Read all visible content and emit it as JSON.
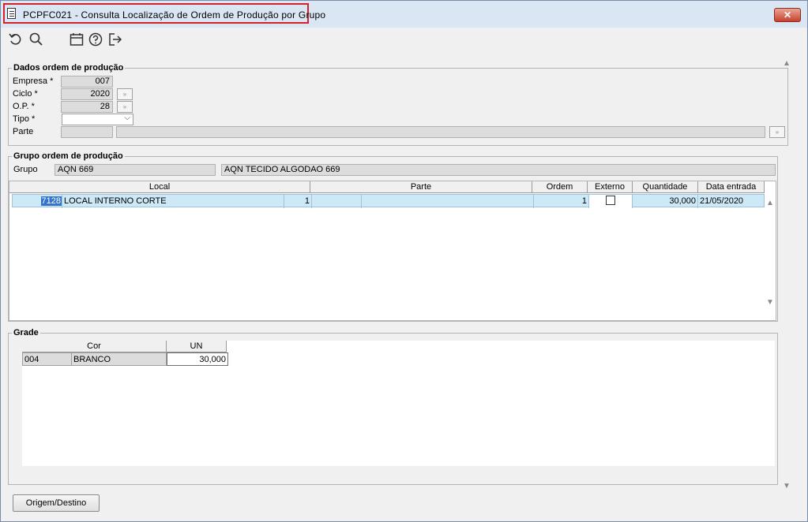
{
  "window": {
    "title": "PCPFC021 - Consulta Localização de Ordem de Produção por Grupo",
    "close_label": "✕"
  },
  "toolbar": {
    "icons": [
      "undo-icon",
      "search-icon",
      "calendar-icon",
      "help-icon",
      "exit-icon"
    ]
  },
  "dados": {
    "legend": "Dados ordem de produção",
    "empresa_label": "Empresa *",
    "empresa_value": "007",
    "ciclo_label": "Ciclo *",
    "ciclo_value": "2020",
    "op_label": "O.P. *",
    "op_value": "28",
    "tipo_label": "Tipo *",
    "tipo_value": "",
    "parte_label": "Parte",
    "parte_code": "",
    "parte_desc": ""
  },
  "grupo": {
    "legend": "Grupo ordem de produção",
    "grupo_label": "Grupo",
    "grupo_code": "AQN 669",
    "grupo_desc": "AQN TECIDO ALGODAO 669"
  },
  "local_table": {
    "headers": {
      "local": "Local",
      "parte": "Parte",
      "ordem": "Ordem",
      "externo": "Externo",
      "quantidade": "Quantidade",
      "data": "Data entrada"
    },
    "rows": [
      {
        "local_code": "7128",
        "local_name": "LOCAL INTERNO CORTE",
        "num": "1",
        "parte_code": "",
        "parte_desc": "",
        "ordem": "1",
        "externo": false,
        "quantidade": "30,000",
        "data": "21/05/2020"
      }
    ]
  },
  "grade": {
    "legend": "Grade",
    "headers": {
      "cor": "Cor",
      "un": "UN"
    },
    "rows": [
      {
        "cor_code": "004",
        "cor_name": "BRANCO",
        "un": "30,000"
      }
    ]
  },
  "footer": {
    "origem_label": "Origem/Destino"
  }
}
